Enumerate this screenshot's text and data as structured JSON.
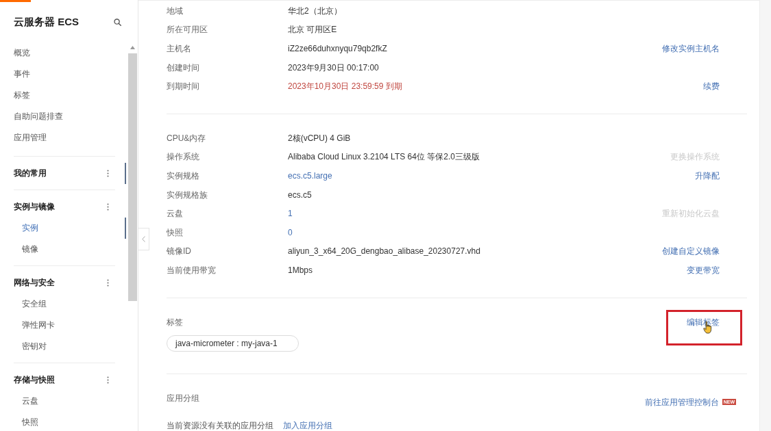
{
  "sidebar": {
    "title": "云服务器 ECS",
    "items": [
      {
        "label": "概览",
        "selected": false
      },
      {
        "label": "事件",
        "selected": false
      },
      {
        "label": "标签",
        "selected": false
      },
      {
        "label": "自助问题排查",
        "selected": false
      },
      {
        "label": "应用管理",
        "selected": false
      }
    ],
    "groups": [
      {
        "title": "我的常用",
        "marked": true
      },
      {
        "title": "实例与镜像",
        "marked": false,
        "items": [
          {
            "label": "实例",
            "selected": true
          },
          {
            "label": "镜像",
            "selected": false
          }
        ]
      },
      {
        "title": "网络与安全",
        "marked": false,
        "items": [
          {
            "label": "安全组",
            "selected": false
          },
          {
            "label": "弹性网卡",
            "selected": false
          },
          {
            "label": "密钥对",
            "selected": false
          }
        ]
      },
      {
        "title": "存储与快照",
        "marked": false,
        "items": [
          {
            "label": "云盘",
            "selected": false
          },
          {
            "label": "快照",
            "selected": false
          }
        ]
      }
    ]
  },
  "details": [
    {
      "rows": [
        {
          "label": "地域",
          "value": "华北2（北京）",
          "kind": "text"
        },
        {
          "label": "所在可用区",
          "value": "北京 可用区E",
          "kind": "text"
        },
        {
          "label": "主机名",
          "value": "iZ2ze66duhxnyqu79qb2fkZ",
          "kind": "text",
          "action": {
            "label": "修改实例主机名",
            "disabled": false
          }
        },
        {
          "label": "创建时间",
          "value": "2023年9月30日 00:17:00",
          "kind": "text"
        },
        {
          "label": "到期时间",
          "value": "2023年10月30日 23:59:59 到期",
          "kind": "warning",
          "action": {
            "label": "续费",
            "disabled": false
          }
        }
      ]
    },
    {
      "rows": [
        {
          "label": "CPU&内存",
          "value": "2核(vCPU) 4 GiB",
          "kind": "text"
        },
        {
          "label": "操作系统",
          "value": "Alibaba Cloud Linux 3.2104 LTS 64位 等保2.0三级版",
          "kind": "text",
          "action": {
            "label": "更换操作系统",
            "disabled": true
          }
        },
        {
          "label": "实例规格",
          "value": "ecs.c5.large",
          "kind": "link",
          "action": {
            "label": "升降配",
            "disabled": false
          }
        },
        {
          "label": "实例规格族",
          "value": "ecs.c5",
          "kind": "text"
        },
        {
          "label": "云盘",
          "value": "1",
          "kind": "link",
          "action": {
            "label": "重新初始化云盘",
            "disabled": true
          }
        },
        {
          "label": "快照",
          "value": "0",
          "kind": "link"
        },
        {
          "label": "镜像ID",
          "value": "aliyun_3_x64_20G_dengbao_alibase_20230727.vhd",
          "kind": "text",
          "action": {
            "label": "创建自定义镜像",
            "disabled": false
          }
        },
        {
          "label": "当前使用带宽",
          "value": "1Mbps",
          "kind": "text",
          "action": {
            "label": "变更带宽",
            "disabled": false
          }
        }
      ]
    }
  ],
  "tags": {
    "title": "标签",
    "action": {
      "label": "编辑标签",
      "disabled": false,
      "highlighted": true,
      "hovered": true
    },
    "items": [
      "java-micrometer : my-java-1"
    ]
  },
  "app_group": {
    "title": "应用分组",
    "action": {
      "label": "前往应用管理控制台",
      "badge": "NEW"
    },
    "message": "当前资源没有关联的应用分组",
    "link": "加入应用分组"
  }
}
